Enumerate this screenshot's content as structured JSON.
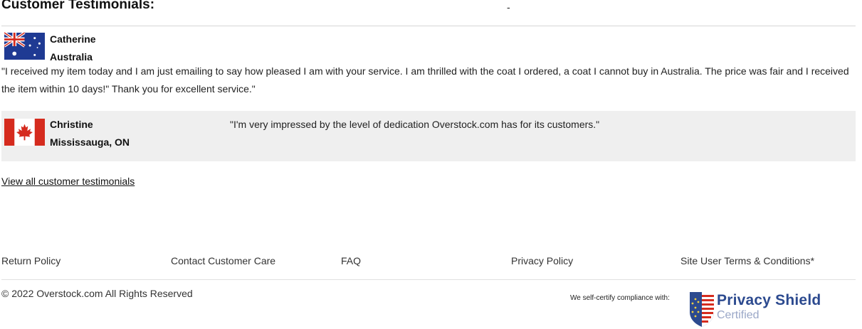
{
  "testimonials": {
    "heading": "Customer Testimonials:",
    "header_dash": "-",
    "items": [
      {
        "name": "Catherine",
        "location": "Australia",
        "flag_icon": "australia-flag-icon",
        "quote": "\"I received my item today and I am just emailing to say how pleased I am with your service. I am thrilled with the coat I ordered, a coat I cannot buy in Australia. The price was fair and I received the item within 10 days!\" Thank you for excellent service.\""
      },
      {
        "name": "Christine",
        "location": "Mississauga, ON",
        "flag_icon": "canada-flag-icon",
        "quote": "\"I'm very impressed by the level of dedication Overstock.com has for its customers.\""
      }
    ],
    "view_all_label": "View all customer testimonials"
  },
  "footer": {
    "links": [
      "Return Policy",
      "Contact Customer Care",
      "FAQ",
      "Privacy Policy",
      "Site User Terms & Conditions*"
    ],
    "copyright": "© 2022 Overstock.com All Rights Reserved",
    "certify_text": "We self-certify compliance with:",
    "privacy_shield": {
      "title": "Privacy Shield",
      "subtitle": "Certified",
      "icon": "privacy-shield-badge-icon"
    }
  },
  "colors": {
    "highlight_row": "#efefef",
    "shield_blue": "#2c4a8f",
    "shield_light": "#9aa7c7"
  }
}
